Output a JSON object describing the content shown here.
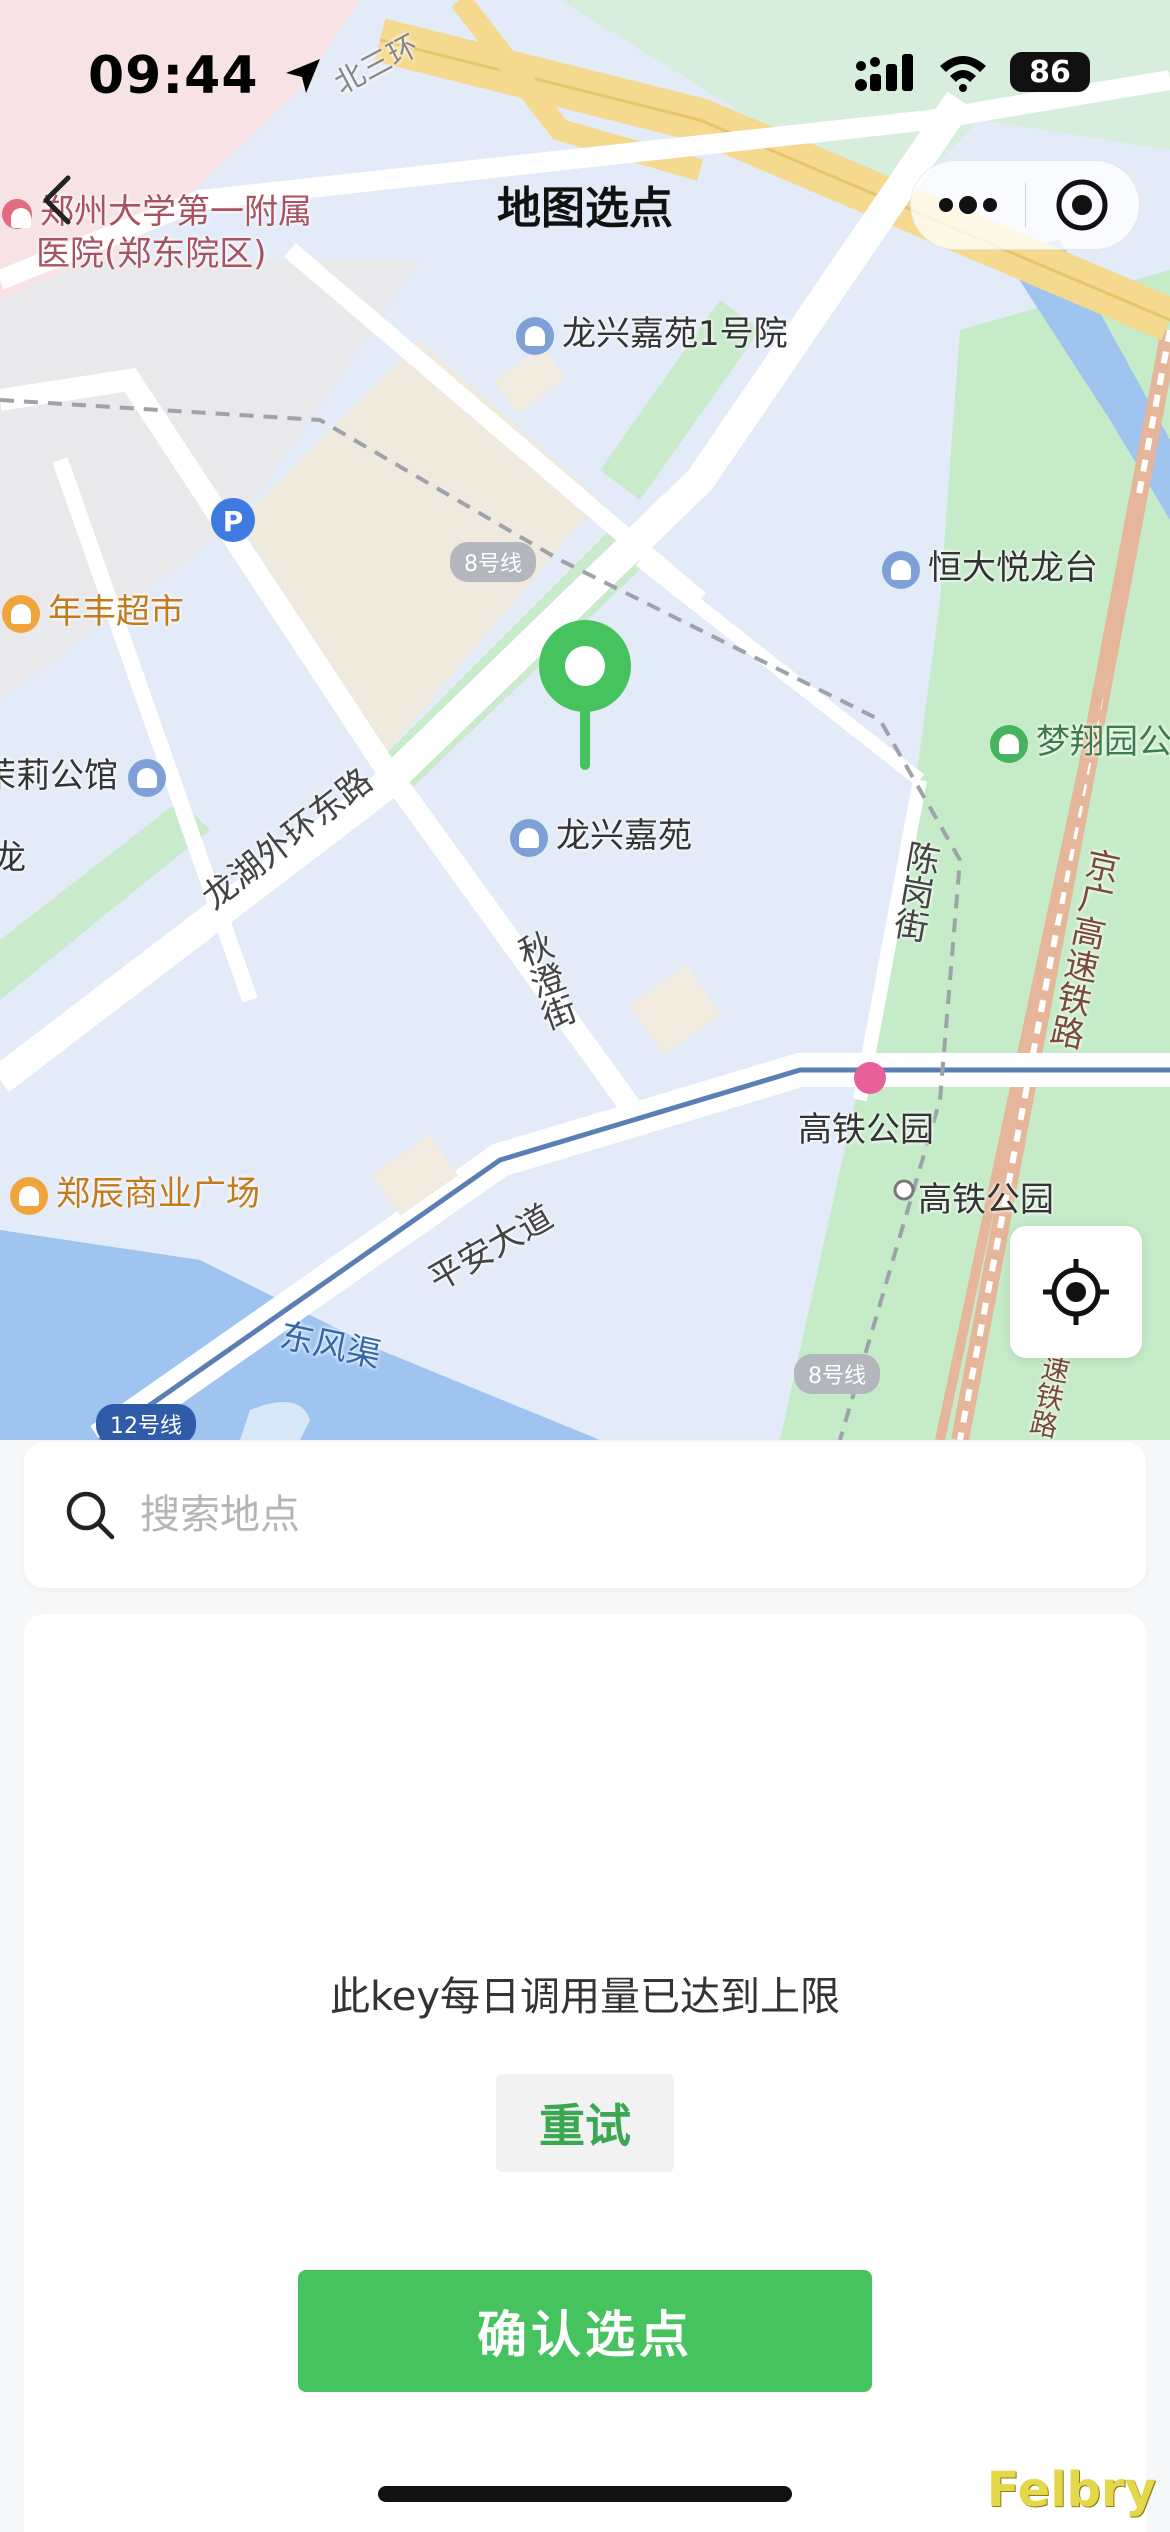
{
  "status_bar": {
    "time": "09:44",
    "battery": "86"
  },
  "nav": {
    "title": "地图选点"
  },
  "map": {
    "labels": {
      "hospital_line1": "郑州大学第一附属",
      "hospital_line2": "医院(郑东院区)",
      "longxing_1": "龙兴嘉苑1号院",
      "hengda": "恒大悦龙台",
      "nianfeng": "年丰超市",
      "mengxiang": "梦翔园公",
      "moli": "茉莉公馆",
      "long_partial": "龙",
      "longxing": "龙兴嘉苑",
      "longhu_road": "龙湖外环东路",
      "qiucheng_st": "秋澄街",
      "chengang_st": "陈岗街",
      "jingguang": "京广高速铁路",
      "gaotie_park_station": "高铁公园",
      "gaotie_park": "高铁公园",
      "zhengchen": "郑辰商业广场",
      "pingan": "平安大道",
      "dongfeng": "东风渠",
      "beisanhuan": "北三环",
      "su_partial": "速铁路"
    },
    "metro": {
      "line8_top": "8号线",
      "line8_bottom": "8号线",
      "line12": "12号线"
    },
    "colors": {
      "pin": "#46c35f",
      "water": "#9ec4ef",
      "green": "#c7ebc8",
      "highway": "#f4d98e"
    }
  },
  "search": {
    "placeholder": "搜索地点",
    "value": ""
  },
  "result": {
    "error_message": "此key每日调用量已达到上限",
    "retry_label": "重试",
    "confirm_label": "确认选点"
  },
  "watermark": "Felbry",
  "icons": {
    "back": "chevron-left-icon",
    "more": "more-dots-icon",
    "close": "target-circle-icon",
    "locate": "locate-crosshair-icon",
    "search": "search-icon",
    "pin": "map-pin-icon"
  }
}
